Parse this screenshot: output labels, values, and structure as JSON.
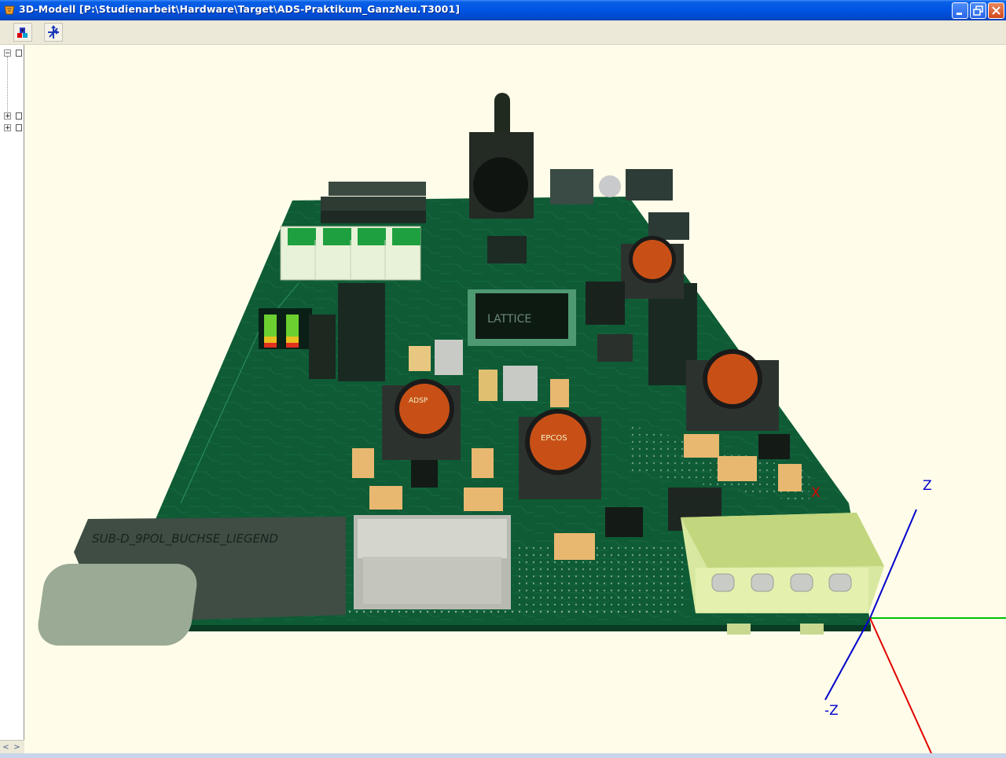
{
  "window": {
    "title": "3D-Modell  [P:\\Studienarbeit\\Hardware\\Target\\ADS-Praktikum_GanzNeu.T3001]"
  },
  "toolbar": {
    "buttons": [
      {
        "icon": "color-cubes-icon"
      },
      {
        "icon": "axis-move-icon"
      }
    ]
  },
  "tree": {
    "nodes": [
      {
        "expander": "−"
      },
      {
        "expander": "+"
      },
      {
        "expander": "+"
      }
    ]
  },
  "scrollbar": {
    "left_arrow": "<",
    "right_arrow": ">"
  },
  "model": {
    "connector_label": "SUB-D_9POL_BUCHSE_LIEGEND",
    "chip_label": "LATTICE",
    "inductor_label": "EPCOS",
    "inductor_label_2": "ADSP"
  },
  "axes": {
    "x_label": "X",
    "z_label": "Z",
    "neg_z_label": "-Z",
    "colors": {
      "x": "#e00000",
      "y": "#00c000",
      "z": "#0000cc"
    }
  },
  "colors": {
    "pcb": "#0d5a34",
    "pcb_dark": "#0a3f25",
    "background": "#fffde9",
    "titlebar": "#0054e3"
  }
}
